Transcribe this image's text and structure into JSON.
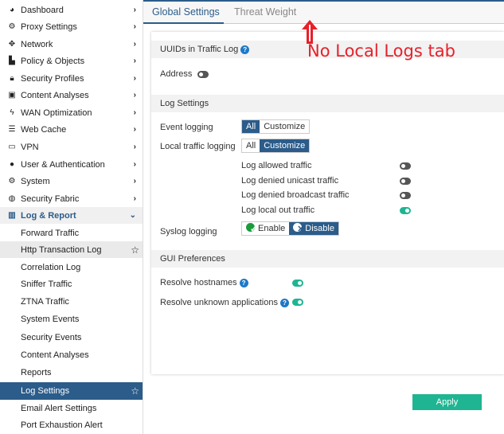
{
  "sidebar": {
    "items": [
      {
        "label": "Dashboard",
        "icon": "dashboard-icon"
      },
      {
        "label": "Proxy Settings",
        "icon": "gear-icon"
      },
      {
        "label": "Network",
        "icon": "network-icon"
      },
      {
        "label": "Policy & Objects",
        "icon": "policy-icon"
      },
      {
        "label": "Security Profiles",
        "icon": "lock-icon"
      },
      {
        "label": "Content Analyses",
        "icon": "image-icon"
      },
      {
        "label": "WAN Optimization",
        "icon": "bolt-icon"
      },
      {
        "label": "Web Cache",
        "icon": "database-icon"
      },
      {
        "label": "VPN",
        "icon": "laptop-icon"
      },
      {
        "label": "User & Authentication",
        "icon": "user-icon"
      },
      {
        "label": "System",
        "icon": "gear-icon"
      },
      {
        "label": "Security Fabric",
        "icon": "fabric-icon"
      },
      {
        "label": "Log & Report",
        "icon": "chart-icon"
      }
    ],
    "sub_items": [
      "Forward Traffic",
      "Http Transaction Log",
      "Correlation Log",
      "Sniffer Traffic",
      "ZTNA Traffic",
      "System Events",
      "Security Events",
      "Content Analyses",
      "Reports",
      "Log Settings",
      "Email Alert Settings",
      "Port Exhaustion Alert"
    ]
  },
  "tabs": [
    "Global Settings",
    "Threat Weight"
  ],
  "annotation": "No Local Logs tab",
  "sections": {
    "uuids": "UUIDs in Traffic Log",
    "log": "Log Settings",
    "gui": "GUI Preferences"
  },
  "address": {
    "label": "Address",
    "on": false
  },
  "event_logging": {
    "label": "Event logging",
    "options": [
      "All",
      "Customize"
    ],
    "selected": "All"
  },
  "local_traffic": {
    "label": "Local traffic logging",
    "options": [
      "All",
      "Customize"
    ],
    "selected": "Customize",
    "toggles": [
      {
        "label": "Log allowed traffic",
        "on": false
      },
      {
        "label": "Log denied unicast traffic",
        "on": false
      },
      {
        "label": "Log denied broadcast traffic",
        "on": false
      },
      {
        "label": "Log local out traffic",
        "on": true
      }
    ]
  },
  "syslog": {
    "label": "Syslog logging",
    "enable": "Enable",
    "disable": "Disable",
    "selected": "Disable"
  },
  "gui": {
    "resolve_hostnames": {
      "label": "Resolve hostnames",
      "on": true
    },
    "resolve_apps": {
      "label": "Resolve unknown applications",
      "on": true
    }
  },
  "apply_label": "Apply",
  "colors": {
    "accent": "#2b5c8a",
    "toggle_on": "#1fb592",
    "annotation": "#e8202a"
  }
}
